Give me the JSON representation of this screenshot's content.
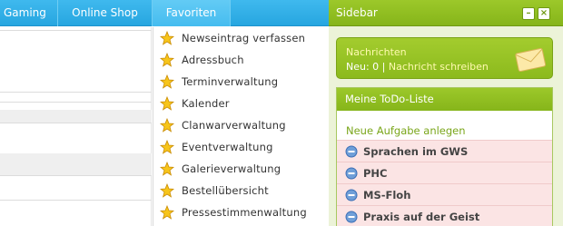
{
  "nav": {
    "tabs": [
      {
        "label": "Gaming"
      },
      {
        "label": "Online Shop"
      },
      {
        "label": "Favoriten"
      }
    ]
  },
  "dropdown": {
    "items": [
      {
        "label": "Newseintrag verfassen",
        "icon": "star-icon"
      },
      {
        "label": "Adressbuch",
        "icon": "star-icon"
      },
      {
        "label": "Terminverwaltung",
        "icon": "star-icon"
      },
      {
        "label": "Kalender",
        "icon": "star-icon"
      },
      {
        "label": "Clanwarverwaltung",
        "icon": "star-icon"
      },
      {
        "label": "Eventverwaltung",
        "icon": "star-icon"
      },
      {
        "label": "Galerieverwaltung",
        "icon": "star-icon"
      },
      {
        "label": "Bestellübersicht",
        "icon": "star-icon"
      },
      {
        "label": "Pressestimmenwaltung",
        "icon": "star-icon"
      }
    ]
  },
  "sidebar": {
    "title": "Sidebar",
    "messages": {
      "title": "Nachrichten",
      "new_label": "Neu: 0",
      "separator": "|",
      "write_link": "Nachricht schreiben"
    },
    "todo": {
      "title": "Meine ToDo-Liste",
      "add_link": "Neue Aufgabe anlegen",
      "items": [
        {
          "label": "Sprachen im GWS"
        },
        {
          "label": "PHC"
        },
        {
          "label": "MS-Floh"
        },
        {
          "label": "Praxis auf der Geist"
        }
      ]
    }
  },
  "colors": {
    "nav_blue": "#27a6e0",
    "sidebar_green": "#8cba1d",
    "todo_row_bg": "#fbe4e4"
  }
}
